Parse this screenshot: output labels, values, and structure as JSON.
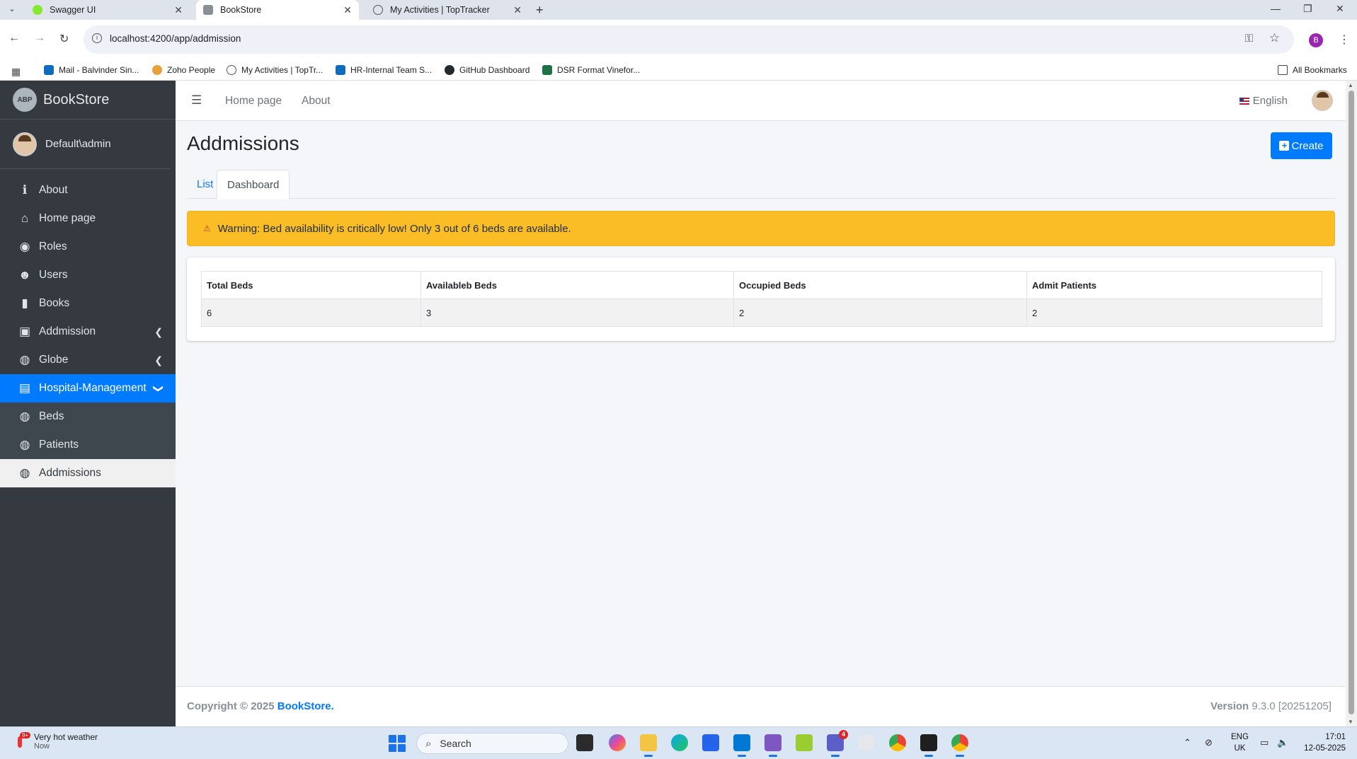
{
  "browser": {
    "tabs": [
      {
        "title": "Swagger UI",
        "favicon": "swagger-icon",
        "color": "#85ea2d",
        "active": false
      },
      {
        "title": "BookStore",
        "favicon": "abp-icon",
        "color": "#6c757d",
        "active": true
      },
      {
        "title": "My Activities | TopTracker",
        "favicon": "toptracker-icon",
        "color": "#555555",
        "active": false
      }
    ],
    "url": "localhost:4200/app/addmission",
    "profile_initial": "B",
    "bookmarks": [
      {
        "label": "Mail - Balvinder Sin...",
        "icon": "outlook-icon",
        "color": "#0f6cbd"
      },
      {
        "label": "Zoho People",
        "icon": "zoho-icon",
        "color": "#e8a13a"
      },
      {
        "label": "My Activities | TopTr...",
        "icon": "toptracker-icon",
        "color": "#555555"
      },
      {
        "label": "HR-Internal Team S...",
        "icon": "sharepoint-icon",
        "color": "#0f6cbd"
      },
      {
        "label": "GitHub Dashboard",
        "icon": "github-icon",
        "color": "#24292e"
      },
      {
        "label": "DSR Format Vinefor...",
        "icon": "excel-icon",
        "color": "#1e7145"
      }
    ],
    "all_bookmarks": "All Bookmarks"
  },
  "sidebar": {
    "brand": "BookStore",
    "logo_text": "ABP",
    "user": "Default\\admin",
    "items": [
      {
        "label": "About",
        "icon": "info-icon",
        "glyph": "ℹ"
      },
      {
        "label": "Home page",
        "icon": "home-icon",
        "glyph": "⌂"
      },
      {
        "label": "Roles",
        "icon": "roles-icon",
        "glyph": "◉"
      },
      {
        "label": "Users",
        "icon": "users-icon",
        "glyph": "☻"
      },
      {
        "label": "Books",
        "icon": "book-icon",
        "glyph": "▮"
      },
      {
        "label": "Addmission",
        "icon": "hospital-user-icon",
        "glyph": "▣",
        "caret": "❮"
      },
      {
        "label": "Globe",
        "icon": "globe-icon",
        "glyph": "◍",
        "caret": "❮"
      },
      {
        "label": "Hospital-Management",
        "icon": "hospital-icon",
        "glyph": "▤",
        "caret": "❯"
      }
    ],
    "subitems": [
      {
        "label": "Beds",
        "icon": "globe-icon",
        "glyph": "◍"
      },
      {
        "label": "Patients",
        "icon": "globe-icon",
        "glyph": "◍"
      },
      {
        "label": "Addmissions",
        "icon": "globe-icon",
        "glyph": "◍"
      }
    ]
  },
  "topnav": {
    "links": [
      "Home page",
      "About"
    ],
    "language": "English"
  },
  "page": {
    "title": "Addmissions",
    "create_label": "Create",
    "tabs": [
      "List",
      "Dashboard"
    ],
    "warning": "Warning: Bed availability is critically low! Only 3 out of 6 beds are available."
  },
  "table": {
    "headers": [
      "Total Beds",
      "Availableb Beds",
      "Occupied Beds",
      "Admit Patients"
    ],
    "rows": [
      [
        "6",
        "3",
        "2",
        "2"
      ]
    ]
  },
  "footer": {
    "copyright": "Copyright © 2025",
    "brand": "BookStore.",
    "version_label": "Version",
    "version_value": "9.3.0 [20251205]"
  },
  "taskbar": {
    "weather_title": "Very hot weather",
    "weather_sub": "Now",
    "weather_badge": "9+",
    "search_placeholder": "Search",
    "lang_top": "ENG",
    "lang_bottom": "UK",
    "time": "17:01",
    "date": "12-05-2025",
    "teams_badge": "4"
  },
  "colors": {
    "accent": "#007bff",
    "sidebar_bg": "#343a40",
    "warning_bg": "#fabd25"
  }
}
